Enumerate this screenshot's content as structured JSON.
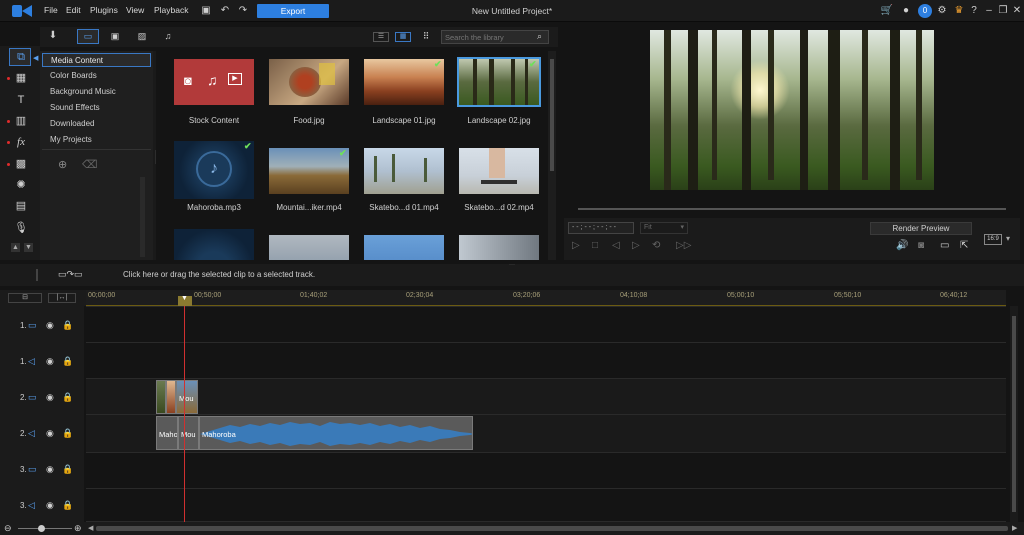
{
  "menu": {
    "file": "File",
    "edit": "Edit",
    "plugins": "Plugins",
    "view": "View",
    "playback": "Playback"
  },
  "export_label": "Export",
  "project_title": "New Untitled Project*",
  "notification_count": "0",
  "search": {
    "placeholder": "Search the library"
  },
  "categories": [
    {
      "label": "Media Content",
      "active": true
    },
    {
      "label": "Color Boards"
    },
    {
      "label": "Background Music"
    },
    {
      "label": "Sound Effects"
    },
    {
      "label": "Downloaded"
    },
    {
      "label": "My Projects"
    }
  ],
  "media_items": [
    {
      "label": "Stock Content"
    },
    {
      "label": "Food.jpg"
    },
    {
      "label": "Landscape 01.jpg"
    },
    {
      "label": "Landscape 02.jpg"
    },
    {
      "label": "Mahoroba.mp3"
    },
    {
      "label": "Mountai...iker.mp4"
    },
    {
      "label": "Skatebo...d 01.mp4"
    },
    {
      "label": "Skatebo...d 02.mp4"
    }
  ],
  "preview": {
    "timecode": "- - ; - - ; - - ; - -",
    "quality": "Fit",
    "render_label": "Render Preview",
    "aspect": "16:9"
  },
  "timeline": {
    "hint": "Click here or drag the selected clip to a selected track.",
    "ruler": [
      "00;00;00",
      "00;50;00",
      "01;40;02",
      "02;30;04",
      "03;20;06",
      "04;10;08",
      "05;00;10",
      "05;50;10",
      "06;40;12"
    ],
    "tracks": [
      "1.",
      "1.",
      "2.",
      "2.",
      "3.",
      "3."
    ],
    "clips": {
      "video_mou": "Mou",
      "audio_mah1": "Maho",
      "audio_mou": "Mou",
      "audio_mah2": "Mahoroba"
    }
  }
}
